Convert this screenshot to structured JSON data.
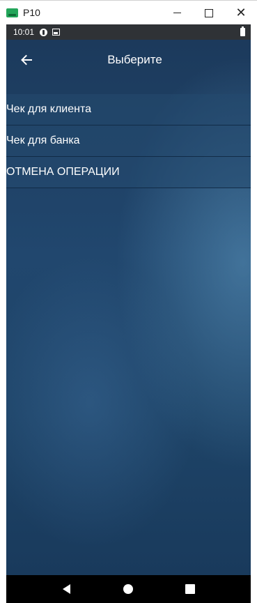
{
  "window": {
    "title": "P10",
    "icon": "emulator-app-icon",
    "controls": [
      "minimize",
      "maximize",
      "close"
    ],
    "close_glyph": "✕"
  },
  "statusbar": {
    "time": "10:01",
    "icons": [
      "sync-status-icon",
      "image-notification-icon",
      "battery-icon"
    ]
  },
  "appbar": {
    "title": "Выберите",
    "back_icon": "arrow-left-icon"
  },
  "menu": {
    "items": [
      {
        "label": "Чек для клиента"
      },
      {
        "label": "Чек для банка"
      },
      {
        "label": "ОТМЕНА ОПЕРАЦИИ"
      }
    ]
  },
  "navbar": {
    "buttons": [
      "back-triangle-icon",
      "home-circle-icon",
      "recents-square-icon"
    ]
  },
  "colors": {
    "background": "#1e4468",
    "statusbar": "#2f3236",
    "list_item": "#2a5078",
    "text": "#ffffff"
  }
}
